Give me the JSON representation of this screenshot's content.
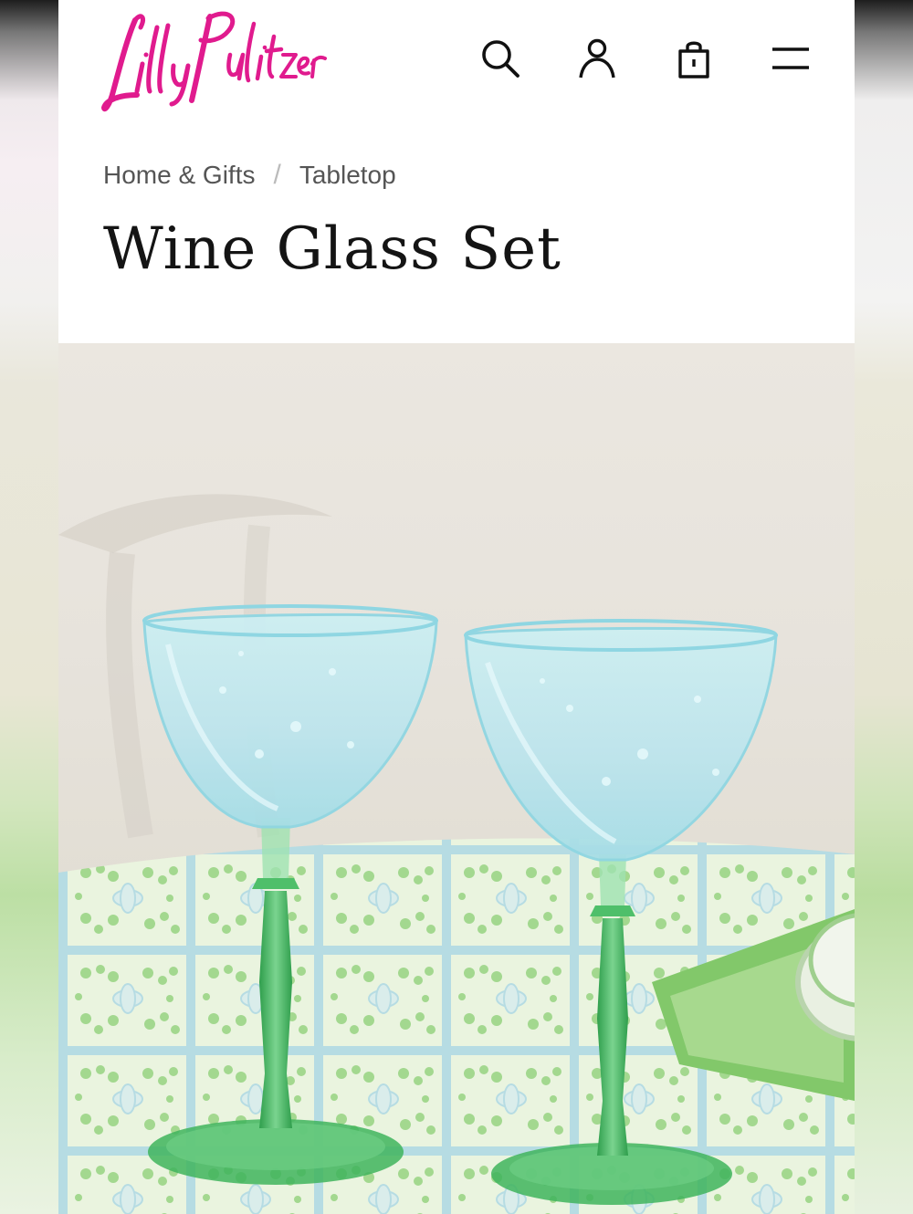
{
  "brand": {
    "logo_text": "Lilly Pulitzer",
    "color": "#e01b8e"
  },
  "header": {
    "icons": [
      {
        "name": "search-icon"
      },
      {
        "name": "account-icon"
      },
      {
        "name": "shopping-bag-icon"
      },
      {
        "name": "menu-icon"
      }
    ]
  },
  "breadcrumb": {
    "items": [
      {
        "label": "Home & Gifts"
      },
      {
        "label": "Tabletop"
      }
    ],
    "separator": "/"
  },
  "product": {
    "title": "Wine Glass Set",
    "image_alt_icon": "product-photo"
  },
  "colors": {
    "glass_bowl": "#bfe7ec",
    "glass_stem": "#4fbf6a",
    "tablecloth_green": "#8fd07a",
    "tablecloth_blue": "#a9d6ea"
  }
}
